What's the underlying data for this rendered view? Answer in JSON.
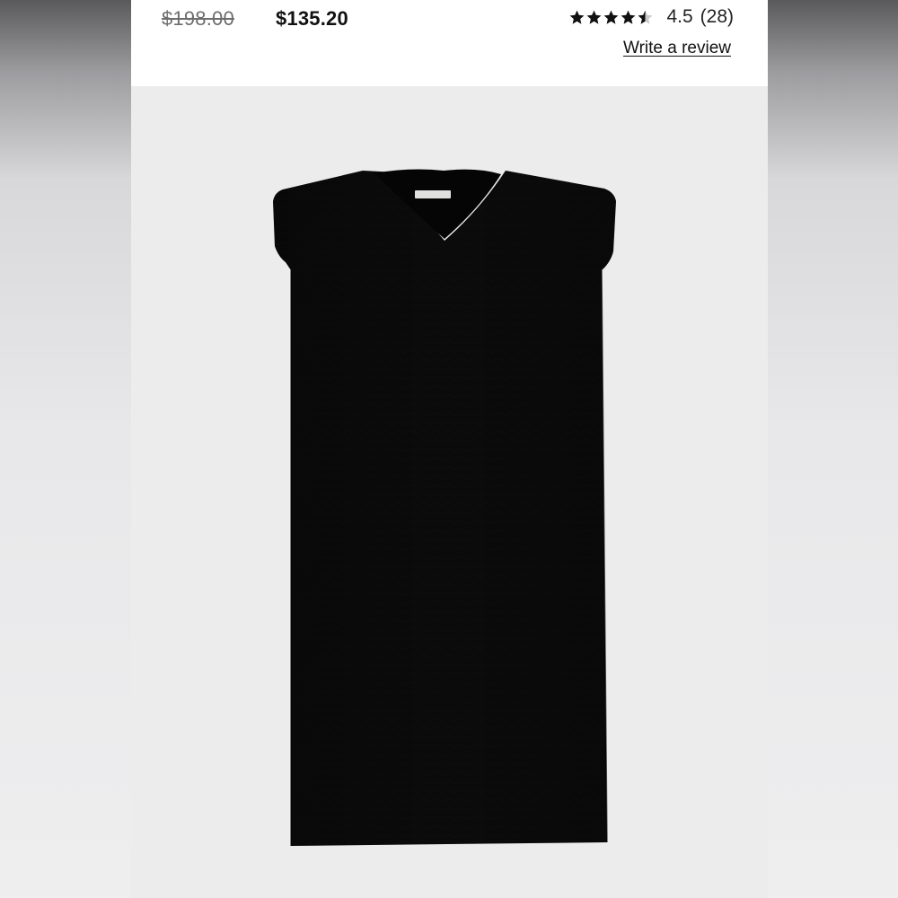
{
  "product": {
    "original_price": "$198.00",
    "sale_price": "$135.20",
    "rating_value": 4.5,
    "rating_text": "4.5",
    "review_count_text": "(28)",
    "write_review_label": "Write a review",
    "image_alt": "Black short-sleeve V-neck dress",
    "image_icon": "dress-photo"
  },
  "colors": {
    "star": "#111111",
    "star_empty": "#c9c9c9",
    "dress": "#0b0b0b",
    "photo_bg": "#ececed"
  }
}
